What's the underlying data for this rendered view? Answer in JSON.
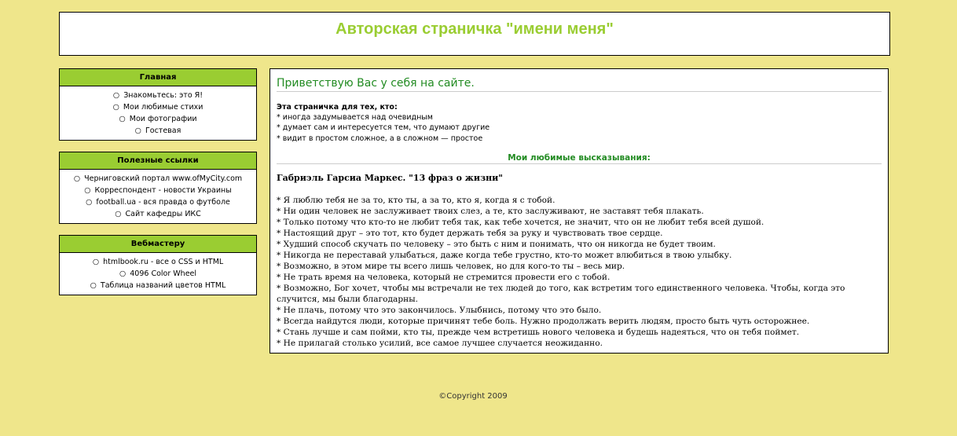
{
  "header": {
    "title": "Авторская страничка \"имени меня\""
  },
  "sidebar": {
    "boxes": [
      {
        "title": "Главная",
        "items": [
          "Знакомьтесь: это Я!",
          "Мои любимые стихи",
          "Мои фотографии",
          "Гостевая"
        ]
      },
      {
        "title": "Полезные ссылки",
        "items": [
          "Черниговский портал www.ofMyCity.com",
          "Корреспондент - новости Украины",
          "football.ua - вся правда о футболе",
          "Сайт кафедры ИКС"
        ]
      },
      {
        "title": "Вебмастеру",
        "items": [
          "htmlbook.ru - все о CSS и HTML",
          "4096 Color Wheel",
          "Таблица названий цветов HTML"
        ]
      }
    ]
  },
  "main": {
    "greeting": "Приветствую Вас у себя на сайте.",
    "intro_head": "Эта страничка для тех, кто:",
    "intro_lines": [
      "* иногда задумывается над очевидным",
      "* думает сам и интересуется тем, что думают другие",
      "* видит в простом сложное, а в сложном — простое"
    ],
    "favorites_title": "Мои любимые высказывания:",
    "quote_title": "Габриэль Гарсиа Маркес. \"13 фраз о жизни\"",
    "quotes": [
      "* Я люблю тебя не за то, кто ты, а за то, кто я, когда я с тобой.",
      "* Ни один человек не заслуживает твоих слез, а те, кто заслуживают, не заставят тебя плакать.",
      "* Только потому что кто-то не любит тебя так, как тебе хочется, не значит, что он не любит тебя всей душой.",
      "* Настоящий друг – это тот, кто будет держать тебя за руку и чувствовать твое сердце.",
      "* Худший способ скучать по человеку – это быть с ним и понимать, что он никогда не будет твоим.",
      "* Никогда не переставай улыбаться, даже когда тебе грустно, кто-то может влюбиться в твою улыбку.",
      "* Возможно, в этом мире ты всего лишь человек, но для кого-то ты – весь мир.",
      "* Не трать время на человека, который не стремится провести его с тобой.",
      "* Возможно, Бог хочет, чтобы мы встречали не тех людей до того, как встретим того единственного человека. Чтобы, когда это случится, мы были благодарны.",
      "* Не плачь, потому что это закончилось. Улыбнись, потому что это было.",
      "* Всегда найдутся люди, которые причинят тебе боль. Нужно продолжать верить людям, просто быть чуть осторожнее.",
      "* Стань лучше и сам пойми, кто ты, прежде чем встретишь нового человека и будешь надеяться, что он тебя поймет.",
      "* Не прилагай столько усилий, все самое лучшее случается неожиданно."
    ]
  },
  "footer": {
    "copyright": "©Copyright 2009"
  },
  "colors": {
    "background": "#efe68b",
    "accent": "#9acd32",
    "green_text": "#228b22"
  }
}
